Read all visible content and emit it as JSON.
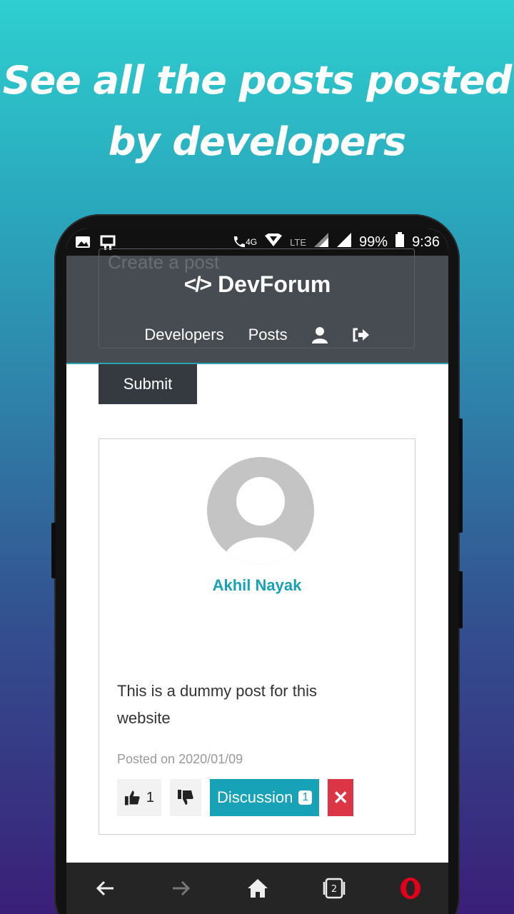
{
  "headline": "See all the posts posted by developers",
  "status_bar": {
    "network": "4G",
    "lte": "LTE",
    "battery": "99%",
    "time": "9:36"
  },
  "background_form": {
    "placeholder_hint": "Create a post"
  },
  "navbar": {
    "brand": "DevForum",
    "brand_icon": "code-icon",
    "links": [
      "Developers",
      "Posts"
    ],
    "icons": [
      "user-icon",
      "sign-out-icon"
    ]
  },
  "submit_label": "Submit",
  "post": {
    "author": "Akhil Nayak",
    "text": "This is a dummy post for this website",
    "posted": "Posted on 2020/01/09",
    "likes": "1",
    "discussion_label": "Discussion",
    "discussion_count": "1",
    "delete_label": "✕"
  },
  "colors": {
    "accent": "#17a2b8",
    "navbar": "#474b52",
    "danger": "#dc3545",
    "dark_button": "#343a40"
  }
}
